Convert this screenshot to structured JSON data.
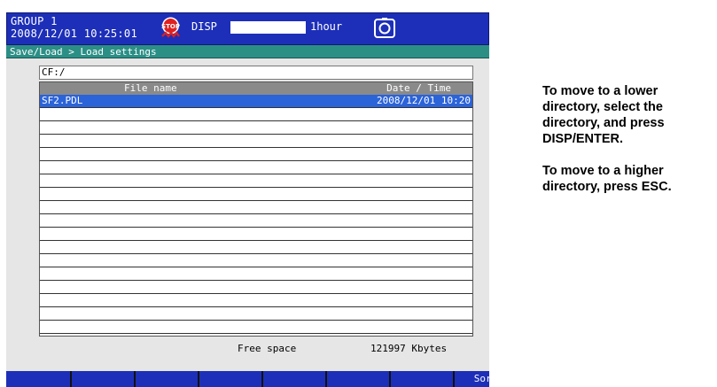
{
  "status": {
    "group": "GROUP 1",
    "datetime": "2008/12/01 10:25:01",
    "disp_label": "DISP",
    "hour_label": "1hour",
    "icons": {
      "stop": "stop-icon",
      "camera": "camera-icon"
    }
  },
  "breadcrumb": "Save/Load > Load settings",
  "path": "CF:/",
  "table": {
    "headers": {
      "name": "File name",
      "date": "Date / Time"
    },
    "rows": [
      {
        "name": "SF2.PDL",
        "date": "2008/12/01 10:20",
        "selected": true
      }
    ]
  },
  "free_space": {
    "label": "Free space",
    "value": "121997 Kbytes"
  },
  "softkeys": [
    "",
    "",
    "",
    "",
    "",
    "",
    "Sort"
  ],
  "help": [
    "To move to a lower directory, select the directory, and press DISP/ENTER.",
    "To move to a higher directory, press ESC."
  ],
  "colors": {
    "status_bar": "#1d2fb8",
    "breadcrumb_bar": "#2c8f86",
    "selection": "#2b63d9",
    "header": "#8a8a8a"
  }
}
